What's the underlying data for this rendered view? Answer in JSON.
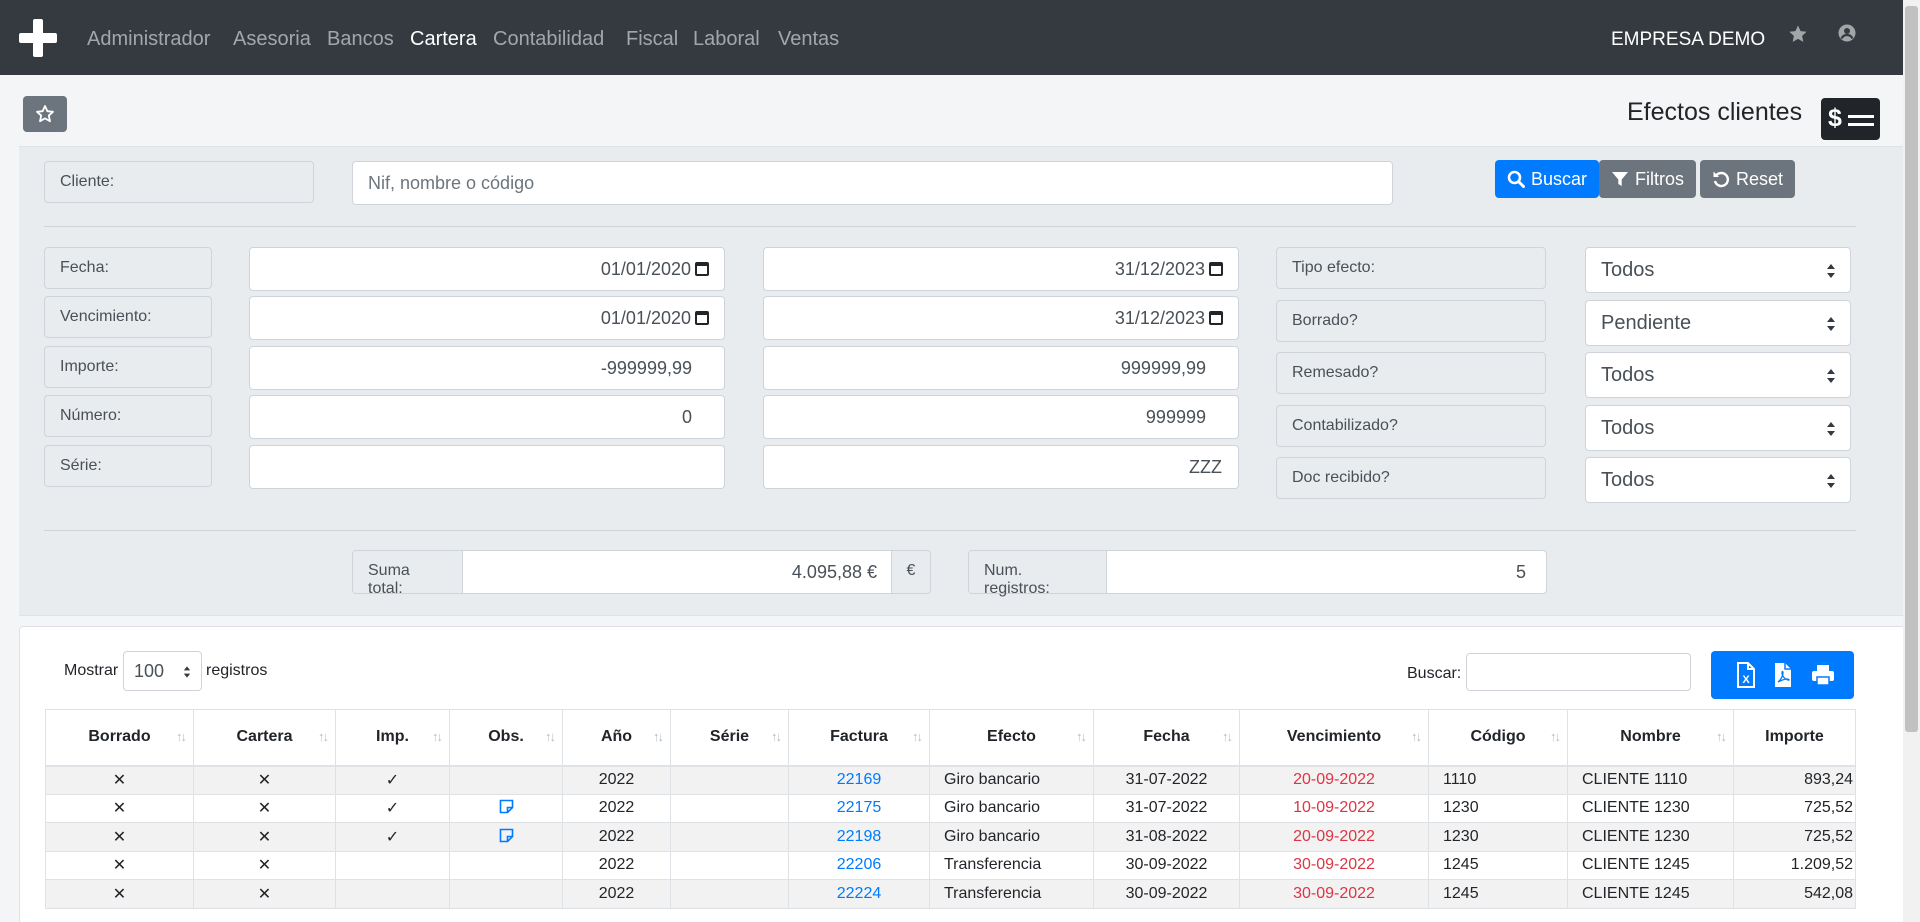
{
  "navbar": {
    "menu": [
      "Administrador",
      "Asesoria",
      "Bancos",
      "Cartera",
      "Contabilidad",
      "Fiscal",
      "Laboral",
      "Ventas"
    ],
    "active": "Cartera",
    "company": "EMPRESA DEMO",
    "icons": [
      "plus-logo-icon",
      "star-icon",
      "user-icon"
    ]
  },
  "page": {
    "title": "Efectos clientes",
    "title_icon": "dollar-lines-icon",
    "fav_icon": "star-outline-icon"
  },
  "filters": {
    "cliente": {
      "label": "Cliente:",
      "placeholder": "Nif, nombre o código"
    },
    "buttons": {
      "buscar": "Buscar",
      "filtros": "Filtros",
      "reset": "Reset"
    },
    "fecha": {
      "label": "Fecha:",
      "from": "01/01/2020",
      "to": "31/12/2023"
    },
    "vencimiento": {
      "label": "Vencimiento:",
      "from": "01/01/2020",
      "to": "31/12/2023"
    },
    "importe": {
      "label": "Importe:",
      "from": "-999999,99",
      "to": "999999,99"
    },
    "numero": {
      "label": "Número:",
      "from": "0",
      "to": "999999"
    },
    "serie": {
      "label": "Série:",
      "from": "",
      "to": "ZZZ"
    },
    "tipo_efecto": {
      "label": "Tipo efecto:",
      "value": "Todos"
    },
    "borrado": {
      "label": "Borrado?",
      "value": "Pendiente"
    },
    "remesado": {
      "label": "Remesado?",
      "value": "Todos"
    },
    "contabilizado": {
      "label": "Contabilizado?",
      "value": "Todos"
    },
    "doc_recibido": {
      "label": "Doc recibido?",
      "value": "Todos"
    }
  },
  "totals": {
    "suma_label": "Suma total:",
    "suma_value": "4.095,88 €",
    "currency": "€",
    "num_label": "Num. registros:",
    "num_value": "5"
  },
  "table_controls": {
    "show_label": "Mostrar",
    "page_length": "100",
    "records_label": "registros",
    "search_label": "Buscar:",
    "export_icons": [
      "excel-icon",
      "pdf-icon",
      "print-icon"
    ]
  },
  "table": {
    "columns": [
      "Borrado",
      "Cartera",
      "Imp.",
      "Obs.",
      "Año",
      "Série",
      "Factura",
      "Efecto",
      "Fecha",
      "Vencimiento",
      "Código",
      "Nombre",
      "Importe"
    ],
    "rows": [
      {
        "borrado": "✕",
        "cartera": "✕",
        "imp": "✓",
        "obs": false,
        "anio": "2022",
        "serie": "",
        "factura": "22169",
        "efecto": "Giro bancario",
        "fecha": "31-07-2022",
        "vencimiento": "20-09-2022",
        "codigo": "1110",
        "nombre": "CLIENTE 1110",
        "importe": "893,24"
      },
      {
        "borrado": "✕",
        "cartera": "✕",
        "imp": "✓",
        "obs": true,
        "anio": "2022",
        "serie": "",
        "factura": "22175",
        "efecto": "Giro bancario",
        "fecha": "31-07-2022",
        "vencimiento": "10-09-2022",
        "codigo": "1230",
        "nombre": "CLIENTE 1230",
        "importe": "725,52"
      },
      {
        "borrado": "✕",
        "cartera": "✕",
        "imp": "✓",
        "obs": true,
        "anio": "2022",
        "serie": "",
        "factura": "22198",
        "efecto": "Giro bancario",
        "fecha": "31-08-2022",
        "vencimiento": "20-09-2022",
        "codigo": "1230",
        "nombre": "CLIENTE 1230",
        "importe": "725,52"
      },
      {
        "borrado": "✕",
        "cartera": "✕",
        "imp": "",
        "obs": false,
        "anio": "2022",
        "serie": "",
        "factura": "22206",
        "efecto": "Transferencia",
        "fecha": "30-09-2022",
        "vencimiento": "30-09-2022",
        "codigo": "1245",
        "nombre": "CLIENTE 1245",
        "importe": "1.209,52"
      },
      {
        "borrado": "✕",
        "cartera": "✕",
        "imp": "",
        "obs": false,
        "anio": "2022",
        "serie": "",
        "factura": "22224",
        "efecto": "Transferencia",
        "fecha": "30-09-2022",
        "vencimiento": "30-09-2022",
        "codigo": "1245",
        "nombre": "CLIENTE 1245",
        "importe": "542,08"
      }
    ]
  },
  "colors": {
    "navbar": "#343a40",
    "primary": "#007bff",
    "secondary": "#6c757d",
    "danger": "#dc3545"
  }
}
